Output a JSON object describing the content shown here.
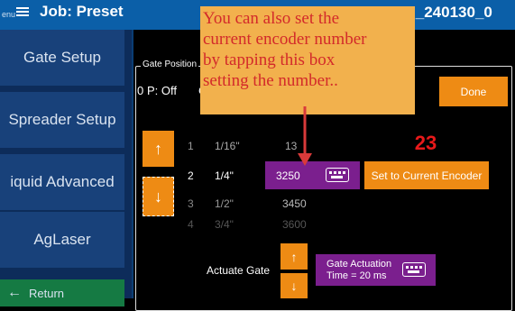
{
  "header": {
    "menu_label": "enu",
    "job_title": "Job: Preset",
    "log_name": "og_240130_0"
  },
  "sidebar": {
    "items": [
      {
        "label": "Gate Setup"
      },
      {
        "label": "Spreader Setup"
      },
      {
        "label": "iquid Advanced"
      },
      {
        "label": "AgLaser"
      },
      {
        "label": "Return"
      }
    ]
  },
  "gate_position": {
    "label": "Gate Position",
    "status_zero": "0",
    "status_text": "P: Off",
    "status_partial": "C",
    "done_label": "Done",
    "rows": [
      {
        "index": "1",
        "fraction": "1/16\"",
        "value": "13"
      },
      {
        "index": "2",
        "fraction": "1/4\"",
        "value": "3250"
      },
      {
        "index": "3",
        "fraction": "1/2\"",
        "value": "3450"
      },
      {
        "index": "4",
        "fraction": "3/4\"",
        "value": "3600"
      }
    ],
    "set_encoder_label": "Set to Current Encoder",
    "arrow_up": "↑",
    "arrow_down": "↓"
  },
  "actuate": {
    "label": "Actuate Gate",
    "box_line1": "Gate Actuation",
    "box_line2": "Time = 20 ms"
  },
  "annotation": {
    "badge": "23",
    "lines": [
      "You can also set the",
      "current encoder number",
      "by tapping this box",
      "setting the number.."
    ]
  },
  "colors": {
    "orange": "#ee8b14",
    "purple": "#7b1f8e",
    "header_blue": "#0b5fa8",
    "sidebar_blue": "#18417a",
    "return_green": "#157a43",
    "callout_bg": "#f2b14d",
    "callout_text": "#d32a2a"
  }
}
